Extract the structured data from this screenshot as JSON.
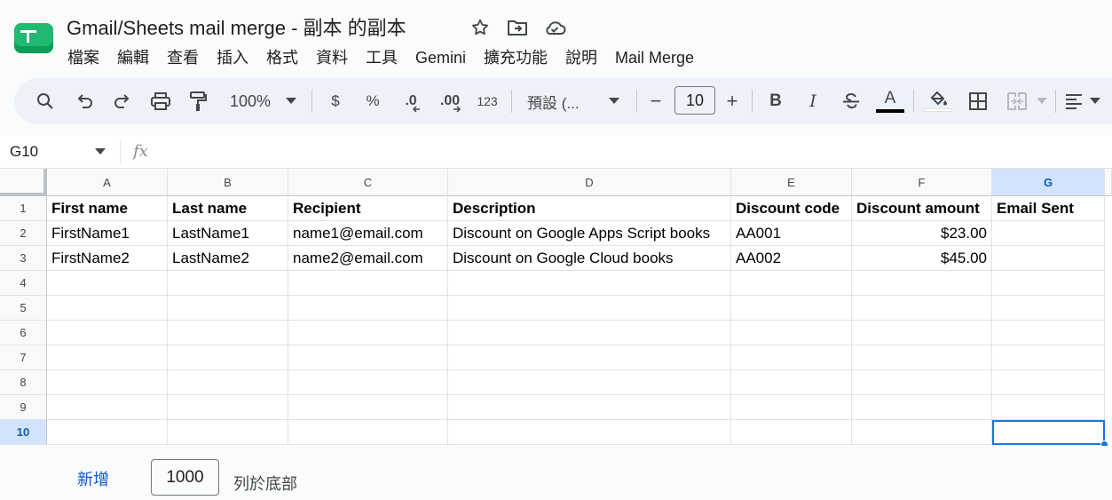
{
  "app": {
    "title": "Gmail/Sheets mail merge  - 副本 的副本",
    "menu": [
      "檔案",
      "編輯",
      "查看",
      "插入",
      "格式",
      "資料",
      "工具",
      "Gemini",
      "擴充功能",
      "說明",
      "Mail Merge"
    ]
  },
  "toolbar": {
    "zoom": "100%",
    "currency": "$",
    "percent": "%",
    "dec_decrease": ".0",
    "dec_increase": ".00",
    "number_format": "123",
    "font": "預設 (...",
    "font_size": "10",
    "minus": "−",
    "plus": "+",
    "bold": "B",
    "italic": "I",
    "text_color_letter": "A"
  },
  "formula_bar": {
    "name_box": "G10",
    "fx": "fx"
  },
  "grid": {
    "columns": [
      "A",
      "B",
      "C",
      "D",
      "E",
      "F",
      "G"
    ],
    "rows": [
      "1",
      "2",
      "3",
      "4",
      "5",
      "6",
      "7",
      "8",
      "9",
      "10"
    ],
    "selected_column": "G",
    "selected_row": "10",
    "header": [
      "First name",
      "Last name",
      "Recipient",
      "Description",
      "Discount code",
      "Discount amount",
      "Email Sent"
    ],
    "data": [
      [
        "FirstName1",
        "LastName1",
        "name1@email.com",
        "Discount on Google Apps Script books",
        "AA001",
        "$23.00",
        ""
      ],
      [
        "FirstName2",
        "LastName2",
        "name2@email.com",
        "Discount on Google Cloud books",
        "AA002",
        "$45.00",
        ""
      ]
    ]
  },
  "bottom": {
    "add_label": "新增",
    "rows_value": "1000",
    "rows_suffix": "列於底部"
  },
  "colors": {
    "accent": "#1a73e8",
    "link": "#0b57d0",
    "sheets_green": "#0f9d58"
  }
}
